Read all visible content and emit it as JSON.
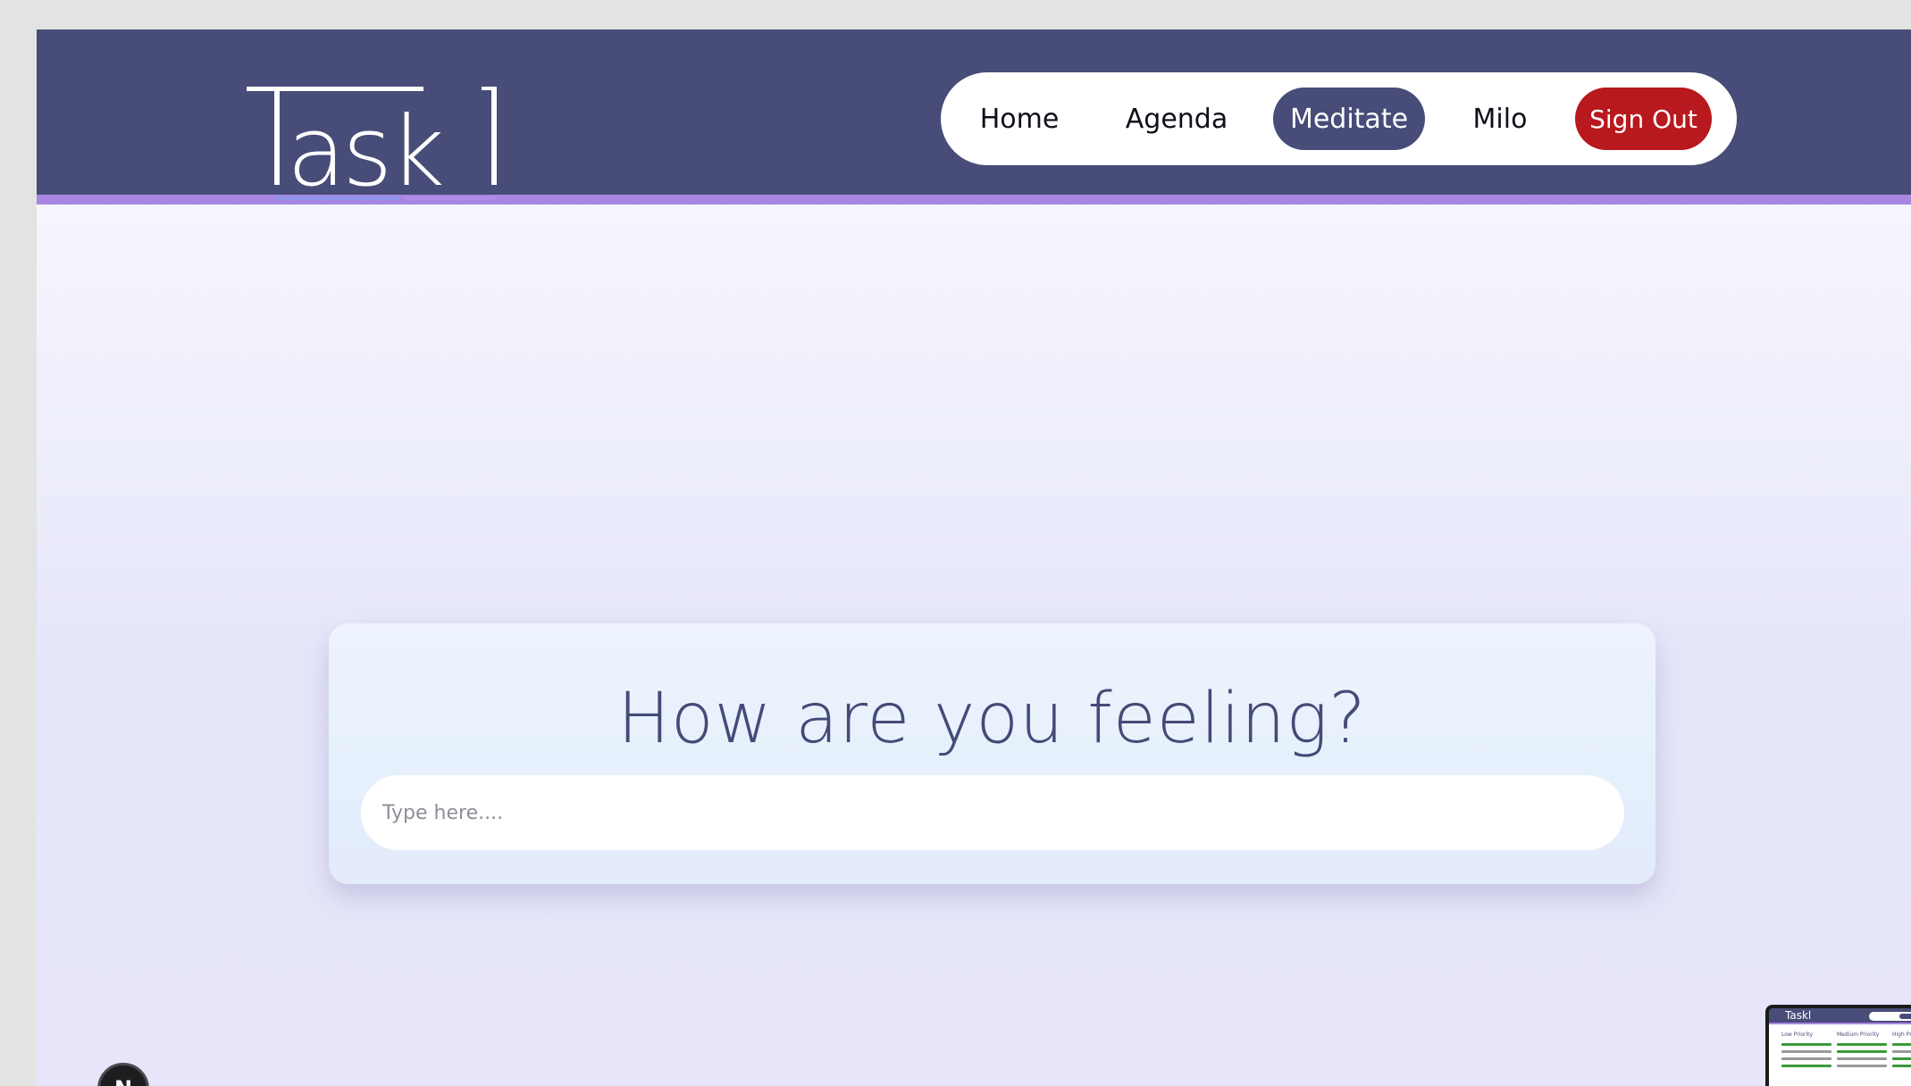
{
  "app": {
    "logo_text": "Taskl"
  },
  "nav": {
    "items": [
      {
        "label": "Home"
      },
      {
        "label": "Agenda"
      },
      {
        "label": "Meditate",
        "active": true
      },
      {
        "label": "Milo"
      }
    ],
    "sign_out_label": "Sign Out"
  },
  "main": {
    "title": "How are you feeling?",
    "input_placeholder": "Type here....",
    "input_value": ""
  },
  "dev_badge": {
    "label": "N"
  },
  "preview": {
    "logo_text": "Taskl",
    "columns": [
      "Low Priority",
      "Medium Priority",
      "High Priority"
    ]
  },
  "colors": {
    "navbar": "#474c78",
    "accent_bar": "#a986e2",
    "active_nav": "#474c78",
    "sign_out": "#b8191e",
    "title": "#454a77"
  }
}
